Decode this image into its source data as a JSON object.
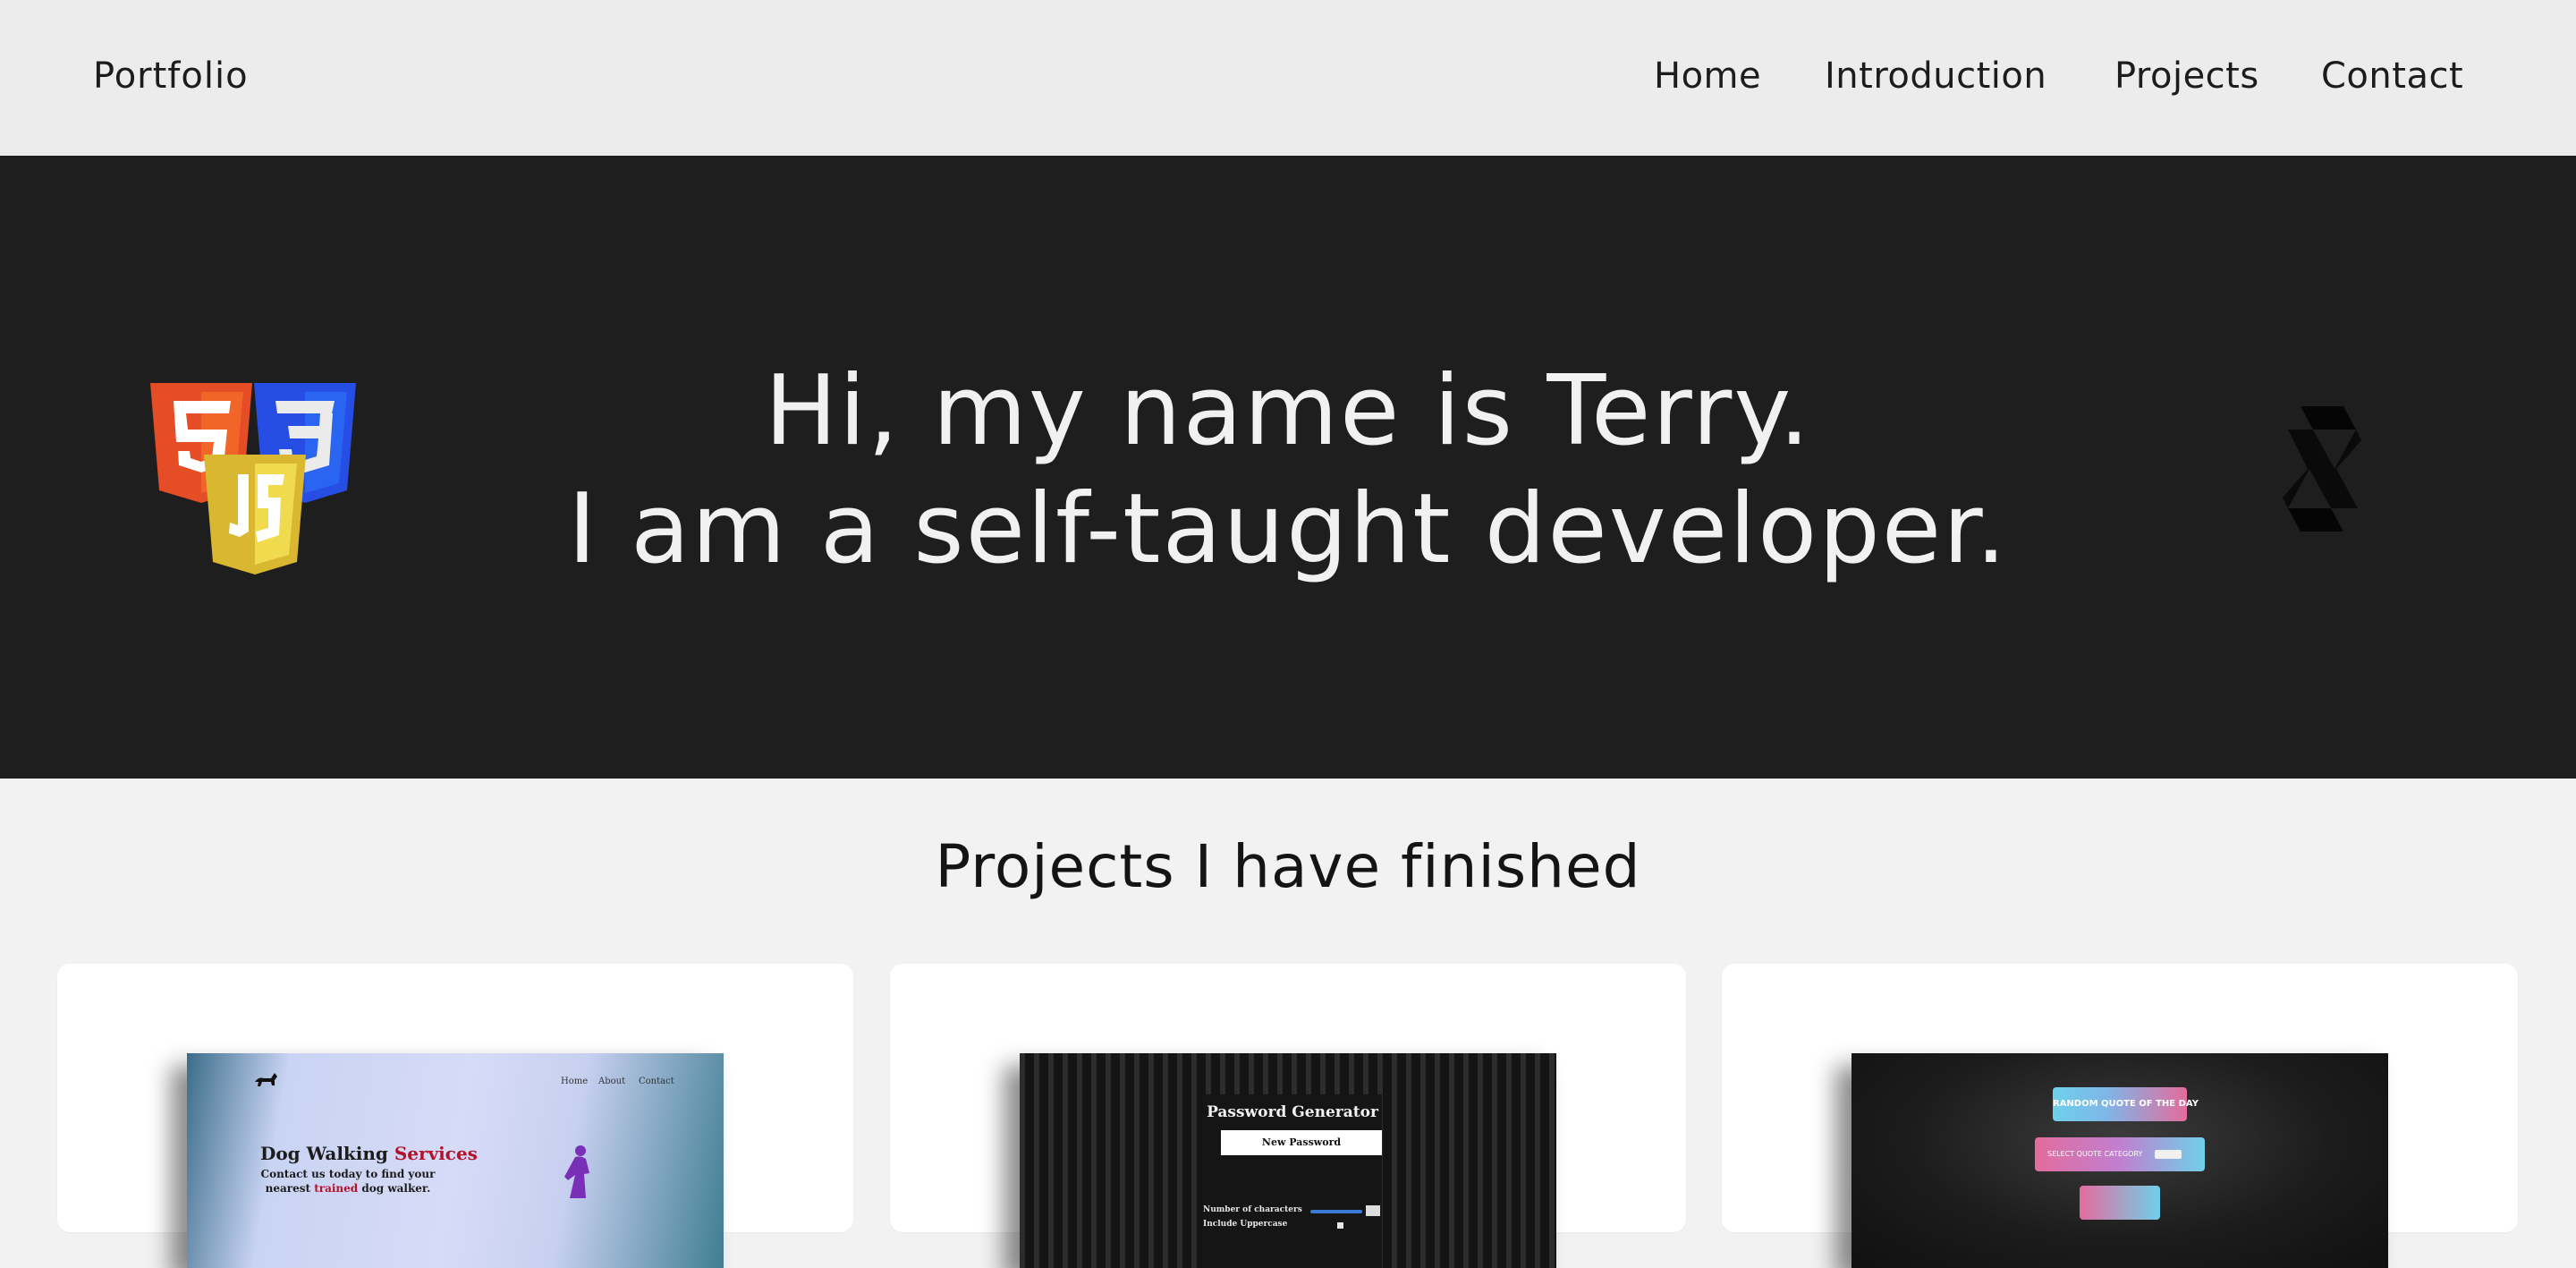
{
  "header": {
    "brand": "Portfolio",
    "nav": [
      "Home",
      "Introduction",
      "Projects",
      "Contact"
    ]
  },
  "hero": {
    "line1": "Hi, my name is Terry.",
    "line2": "I am a self-taught developer.",
    "left_logo_badges": [
      "5",
      "3",
      "JS"
    ]
  },
  "projects": {
    "title": "Projects I have finished",
    "cards": [
      {
        "nav": [
          "Home",
          "About",
          "Contact"
        ],
        "title_main": "Dog Walking",
        "title_accent": "Services",
        "line1": "Contact us today to find your",
        "line2_a": "nearest",
        "line2_accent": "trained",
        "line2_b": "dog walker."
      },
      {
        "title": "Password Generator",
        "button": "New Password",
        "row1": "Number of characters",
        "row2": "Include Uppercase"
      },
      {
        "button1": "RANDOM QUOTE OF THE DAY",
        "button2": "SELECT QUOTE CATEGORY"
      }
    ]
  },
  "colors": {
    "header_bg": "#ececec",
    "hero_bg": "#1e1e1e",
    "page_bg": "#f2f2f2",
    "html5_orange": "#e44d26",
    "css3_blue": "#264de4",
    "js_yellow": "#f0db4f"
  },
  "icons": [
    "html5-logo-icon",
    "css3-logo-icon",
    "javascript-logo-icon",
    "solidity-logo-icon",
    "dog-logo-icon",
    "woman-walking-icon"
  ]
}
